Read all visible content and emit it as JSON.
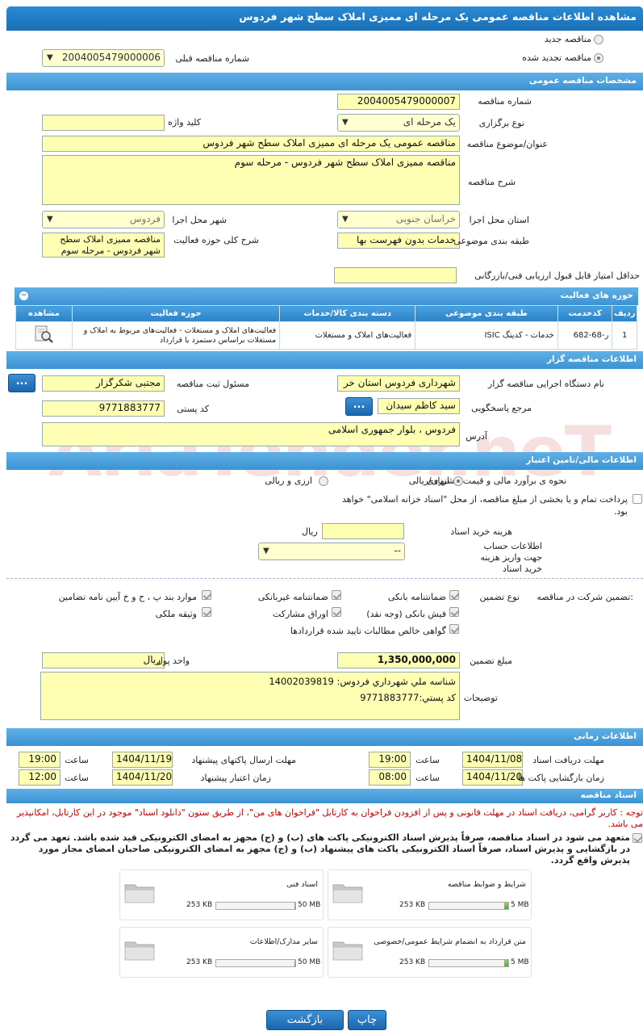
{
  "title": "مشاهده اطلاعات مناقصه عمومی یک مرحله ای ممیزی املاک سطح شهر فردوس",
  "top": {
    "new_label": "مناقصه جدید",
    "renewed_label": "مناقصه تجدید شده",
    "prev_label": "شماره مناقصه قبلی",
    "prev_value": "2004005479000006"
  },
  "general": {
    "header": "مشخصات مناقصه عمومی",
    "number_label": "شماره مناقصه",
    "number_value": "2004005479000007",
    "type_label": "نوع برگزاری",
    "type_value": "یک مرحله ای",
    "keyword_label": "کلید واژه",
    "keyword_value": "",
    "subject_label": "عنوان/موضوع مناقصه",
    "subject_value": "مناقصه عمومی یک مرحله ای ممیزی املاک سطح شهر فردوس",
    "desc_label": "شرح مناقصه",
    "desc_value": "مناقصه ممیزی املاک سطح شهر فردوس - مرحله سوم",
    "province_label": "استان محل اجرا",
    "province_value": "خراسان جنوبی",
    "city_label": "شهر محل اجرا",
    "city_value": "فردوس",
    "category_label": "طبقه بندی موضوعی",
    "category_value": "خدمات بدون فهرست بها",
    "scope_label": "شرح کلی حوزه فعالیت",
    "scope_value": "مناقصه ممیزی املاک سطح شهر فردوس - مرحله سوم",
    "minscore_label": "حداقل امتیاز قابل قبول ارزیابی فنی/بازرگانی",
    "minscore_value": ""
  },
  "activity": {
    "header": "حوزه های فعالیت",
    "columns": [
      "ردیف",
      "کدخدمت",
      "طبقه بندی موضوعی",
      "دسته بندی کالا/خدمات",
      "حوزه فعالیت",
      "مشاهده"
    ],
    "rows": [
      {
        "num": "1",
        "code": "ر-68-682",
        "category": "خدمات - کدینگ ISIC",
        "group": "فعالیت‌های  املاک و مستغلات",
        "field": "فعالیت‌های  املاک و مستغلات - فعالیت‌های مربوط به املاک و مستغلات براساس دستمزد یا قرارداد"
      }
    ]
  },
  "organizer": {
    "header": "اطلاعات مناقصه گزار",
    "org_label": "نام دستگاه اجرایی مناقصه گزار",
    "org_value": "شهرداری فردوس استان خر",
    "registrar_label": "مسئول ثبت مناقصه",
    "registrar_value": "مجتبی شکرگزار",
    "ref_label": "مرجع پاسخگویی",
    "ref_value": "سید کاظم سیدان",
    "postal_label": "کد پستی",
    "postal_value": "9771883777",
    "address_label": "آدرس",
    "address_value": "فردوس ، بلوار جمهوری اسلامی",
    "btn": "..."
  },
  "finance": {
    "header": "اطلاعات مالی/تامین اعتبار",
    "estimate_label": "نحوه ی برآورد مالی و قیمت پیشنهادی",
    "opt_rial": "ارزی/ریالی",
    "opt_fx": "ارزی و ریالی",
    "treasury_label": "پرداخت تمام و یا بخشی از مبلغ مناقصه، از محل \"اسناد خزانه اسلامی\" خواهد بود.",
    "doc_cost_label": "هزینه خرید اسناد",
    "doc_cost_unit": "ریال",
    "doc_cost_value": "",
    "account_label": "اطلاعات حساب جهت واریز هزینه خرید اسناد",
    "account_value": "--"
  },
  "guarantee": {
    "intro_label": "تضمین شرکت در مناقصه:",
    "type_label": "نوع تضمین",
    "options": [
      "ضمانتنامه بانکی",
      "ضمانتنامه غیربانکی",
      "موارد بند پ ، ح و خ آیین نامه تضامین",
      "فیش بانکی (وجه نقد)",
      "اوراق مشارکت",
      "وثیقه ملکی",
      "گواهی خالص مطالبات تایید شده قراردادها"
    ],
    "amount_label": "مبلغ تضمین",
    "amount_value": "1,350,000,000",
    "unit_label": "واحد پول",
    "unit_value": "ریال",
    "notes_label": "توضیحات",
    "notes_line1": "شناسه ملي شهرداري فردوس:   14002039819",
    "notes_line2": "کد پستي:9771883777"
  },
  "timing": {
    "header": "اطلاعات زمانی",
    "doc_receive_label": "مهلت دریافت اسناد",
    "doc_receive_date": "1404/11/08",
    "doc_receive_time": "19:00",
    "send_label": "مهلت ارسال پاکتهای پیشنهاد",
    "send_date": "1404/11/19",
    "send_time": "19:00",
    "open_label": "زمان بازگشایی پاکت ها",
    "open_date": "1404/11/20",
    "open_time": "08:00",
    "validity_label": "زمان اعتبار پیشنهاد",
    "validity_date": "1404/11/20",
    "validity_time": "12:00",
    "time_label": "ساعت"
  },
  "docs": {
    "header": "اسناد مناقصه",
    "notice": "توجه : کاربر گرامی، دریافت اسناد در مهلت قانونی و پس از افزودن فراخوان به کارتابل \"فراخوان های من\"، از طریق ستون \"دانلود اسناد\" موجود در این کارتابل، امکانپذیر می باشد.",
    "commit": "متعهد می شود در اسناد مناقصه، صرفاً پذیرش اسناد الکترونیکی پاکت های (ب) و (ج) مجهز به امضای الکترونیکی قید شده باشد. تعهد می گردد در بازگشایی و پذیرش اسناد، صرفاً اسناد الکترونیکی پاکت های پیشنهاد (ب) و (ج) مجهز به امضای الکترونیکی صاحبان امضای مجاز مورد پذیرش واقع گردد.",
    "files": [
      {
        "name": "شرایط و ضوابط مناقصه",
        "size": "253 KB",
        "max": "5 MB",
        "fill": 0.05
      },
      {
        "name": "اسناد فنی",
        "size": "253 KB",
        "max": "50 MB",
        "fill": 0.005
      },
      {
        "name": "متن قرارداد به انضمام شرایط عمومی/خصوصی",
        "size": "253 KB",
        "max": "5 MB",
        "fill": 0.05
      },
      {
        "name": "سایر مدارک/اطلاعات",
        "size": "253 KB",
        "max": "50 MB",
        "fill": 0.005
      }
    ]
  },
  "buttons": {
    "back": "بازگشت",
    "print": "چاپ"
  },
  "colors": {
    "accent": "#2a82c8",
    "field": "#ffffb3",
    "warning": "#cc0000"
  }
}
